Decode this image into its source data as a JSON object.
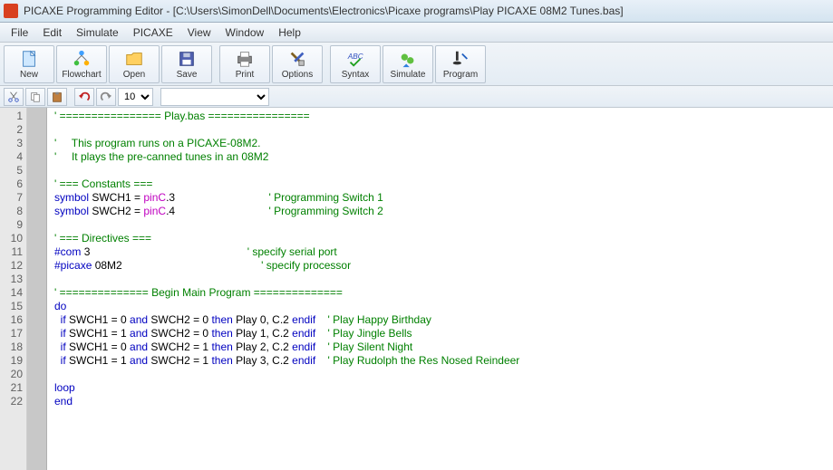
{
  "title": "PICAXE Programming Editor  - [C:\\Users\\SimonDell\\Documents\\Electronics\\Picaxe programs\\Play PICAXE 08M2 Tunes.bas]",
  "menu": [
    "File",
    "Edit",
    "Simulate",
    "PICAXE",
    "View",
    "Window",
    "Help"
  ],
  "toolbar": {
    "new": "New",
    "flowchart": "Flowchart",
    "open": "Open",
    "save": "Save",
    "print": "Print",
    "options": "Options",
    "syntax": "Syntax",
    "simulate": "Simulate",
    "program": "Program"
  },
  "zoom": "10",
  "line_count": 22,
  "code": [
    {
      "n": 1,
      "t": "comment",
      "text": "' ================ Play.bas ================"
    },
    {
      "n": 2,
      "t": "blank",
      "text": ""
    },
    {
      "n": 3,
      "t": "comment",
      "text": "'     This program runs on a PICAXE-08M2."
    },
    {
      "n": 4,
      "t": "comment",
      "text": "'     It plays the pre-canned tunes in an 08M2"
    },
    {
      "n": 5,
      "t": "blank",
      "text": ""
    },
    {
      "n": 6,
      "t": "comment",
      "text": "' === Constants ==="
    },
    {
      "n": 7,
      "t": "symdef",
      "kw": "symbol",
      "name": "SWCH1",
      "eq": " = ",
      "pin": "pinC",
      "dot": ".3",
      "pad": "                               ",
      "tail": "' Programming Switch 1"
    },
    {
      "n": 8,
      "t": "symdef",
      "kw": "symbol",
      "name": "SWCH2",
      "eq": " = ",
      "pin": "pinC",
      "dot": ".4",
      "pad": "                               ",
      "tail": "' Programming Switch 2"
    },
    {
      "n": 9,
      "t": "blank",
      "text": ""
    },
    {
      "n": 10,
      "t": "comment",
      "text": "' === Directives ==="
    },
    {
      "n": 11,
      "t": "direct",
      "kw": "#com ",
      "arg": "3",
      "pad": "                                                    ",
      "tail": "' specify serial port"
    },
    {
      "n": 12,
      "t": "direct",
      "kw": "#picaxe ",
      "arg": "08M2",
      "pad": "                                              ",
      "tail": "' specify processor"
    },
    {
      "n": 13,
      "t": "blank",
      "text": ""
    },
    {
      "n": 14,
      "t": "comment",
      "text": "' ============== Begin Main Program =============="
    },
    {
      "n": 15,
      "t": "kw",
      "text": "do"
    },
    {
      "n": 16,
      "t": "if",
      "lead": "  ",
      "k1": "if ",
      "s1": "SWCH1 = 0 ",
      "k2": "and ",
      "s2": "SWCH2 = 0 ",
      "k3": "then ",
      "s3": "Play 0, C.2 ",
      "k4": "endif",
      "pad": "    ",
      "tail": "' Play Happy Birthday"
    },
    {
      "n": 17,
      "t": "if",
      "lead": "  ",
      "k1": "if ",
      "s1": "SWCH1 = 1 ",
      "k2": "and ",
      "s2": "SWCH2 = 0 ",
      "k3": "then ",
      "s3": "Play 1, C.2 ",
      "k4": "endif",
      "pad": "    ",
      "tail": "' Play Jingle Bells"
    },
    {
      "n": 18,
      "t": "if",
      "lead": "  ",
      "k1": "if ",
      "s1": "SWCH1 = 0 ",
      "k2": "and ",
      "s2": "SWCH2 = 1 ",
      "k3": "then ",
      "s3": "Play 2, C.2 ",
      "k4": "endif",
      "pad": "    ",
      "tail": "' Play Silent Night"
    },
    {
      "n": 19,
      "t": "if",
      "lead": "  ",
      "k1": "if ",
      "s1": "SWCH1 = 1 ",
      "k2": "and ",
      "s2": "SWCH2 = 1 ",
      "k3": "then ",
      "s3": "Play 3, C.2 ",
      "k4": "endif",
      "pad": "    ",
      "tail": "' Play Rudolph the Res Nosed Reindeer"
    },
    {
      "n": 20,
      "t": "blank",
      "text": ""
    },
    {
      "n": 21,
      "t": "kw",
      "text": "loop"
    },
    {
      "n": 22,
      "t": "kw",
      "text": "end"
    }
  ]
}
